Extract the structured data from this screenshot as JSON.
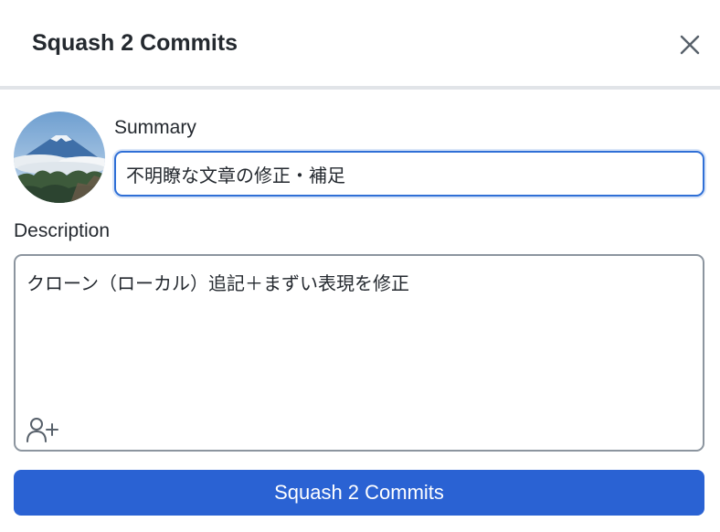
{
  "dialog": {
    "title": "Squash 2 Commits",
    "close_icon": "close-icon"
  },
  "summary": {
    "label": "Summary",
    "value": "不明瞭な文章の修正・補足"
  },
  "description": {
    "label": "Description",
    "value": "クローン（ローカル）追記＋まずい表現を修正",
    "coauthor_icon": "add-user-icon"
  },
  "footer": {
    "submit_label": "Squash 2 Commits"
  },
  "colors": {
    "accent": "#2a62d3",
    "focus_border": "#2f6fd6",
    "border": "#8c959f"
  }
}
